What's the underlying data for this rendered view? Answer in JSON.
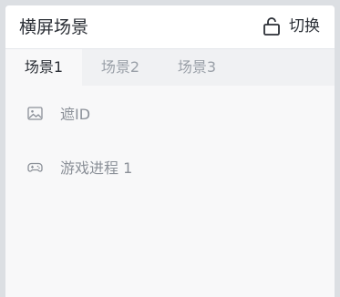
{
  "header": {
    "title": "横屏场景",
    "switch_label": "切换",
    "switch_icon": "unlock-icon"
  },
  "tabs": [
    {
      "label": "场景1",
      "active": true
    },
    {
      "label": "场景2",
      "active": false
    },
    {
      "label": "场景3",
      "active": false
    }
  ],
  "list": [
    {
      "label": "遮ID",
      "icon": "image-icon"
    },
    {
      "label": "游戏进程 1",
      "icon": "gamepad-icon"
    }
  ],
  "colors": {
    "text_primary": "#2b2f36",
    "text_muted": "#9aa0a8",
    "panel_bg": "#f8f8f9",
    "tabbar_bg": "#f0f1f3"
  }
}
